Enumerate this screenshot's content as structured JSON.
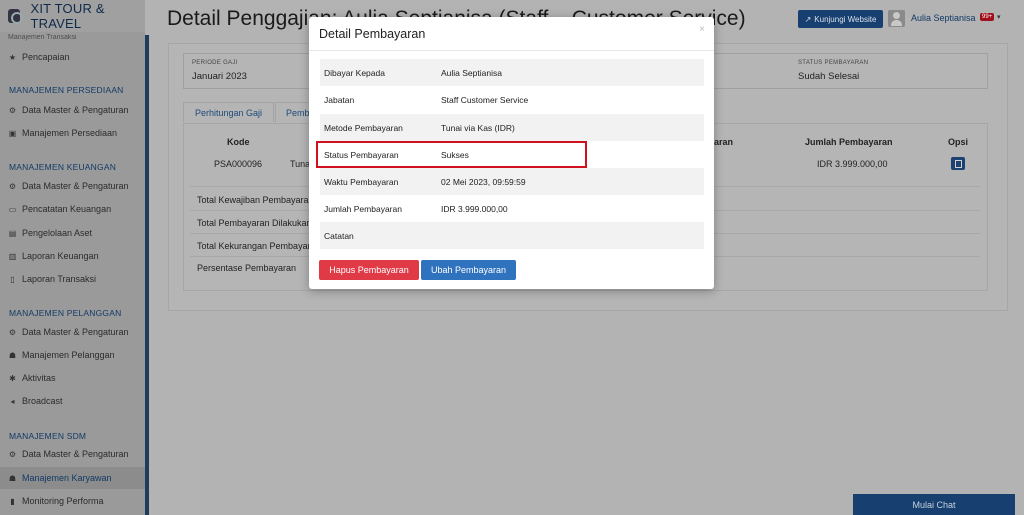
{
  "brand": {
    "name": "XIT TOUR & TRAVEL"
  },
  "sidebar": {
    "top_cut": "Manajemen Transaksi",
    "top_items": [
      {
        "label": "Pencapaian",
        "icon": "star-icon"
      }
    ],
    "sections": [
      {
        "heading": "MANAJEMEN PERSEDIAAN",
        "items": [
          {
            "label": "Data Master & Pengaturan",
            "icon": "cogs-icon"
          },
          {
            "label": "Manajemen Persediaan",
            "icon": "cubes-icon"
          }
        ]
      },
      {
        "heading": "MANAJEMEN KEUANGAN",
        "items": [
          {
            "label": "Data Master & Pengaturan",
            "icon": "cogs-icon"
          },
          {
            "label": "Pencatatan Keuangan",
            "icon": "money-icon"
          },
          {
            "label": "Pengelolaan Aset",
            "icon": "wallet-icon"
          },
          {
            "label": "Laporan Keuangan",
            "icon": "report-icon"
          },
          {
            "label": "Laporan Transaksi",
            "icon": "file-icon"
          }
        ]
      },
      {
        "heading": "MANAJEMEN PELANGGAN",
        "items": [
          {
            "label": "Data Master & Pengaturan",
            "icon": "cogs-icon"
          },
          {
            "label": "Manajemen Pelanggan",
            "icon": "users-icon"
          },
          {
            "label": "Aktivitas",
            "icon": "activity-icon"
          },
          {
            "label": "Broadcast",
            "icon": "bullhorn-icon"
          }
        ]
      },
      {
        "heading": "MANAJEMEN SDM",
        "items": [
          {
            "label": "Data Master & Pengaturan",
            "icon": "cogs-icon"
          },
          {
            "label": "Manajemen Karyawan",
            "icon": "users-icon"
          },
          {
            "label": "Monitoring Performa",
            "icon": "chart-icon"
          }
        ]
      }
    ]
  },
  "header": {
    "title": "Detail Penggajian: Aulia Septianisa (Staff – Customer Service)",
    "visit_button": "Kunjungi Website",
    "username": "Aulia Septianisa",
    "badge": "99+"
  },
  "info": {
    "period_label": "PERIODE GAJI",
    "period_value": "Januari 2023",
    "status_label": "STATUS PEMBAYARAN",
    "status_value": "Sudah Selesai"
  },
  "tabs": {
    "tab1": "Perhitungan Gaji",
    "tab2": "Pembayaran"
  },
  "table": {
    "headers": {
      "kode": "Kode",
      "metode_partial": "aran",
      "jumlah": "Jumlah Pembayaran",
      "opsi": "Opsi"
    },
    "row": {
      "kode": "PSA000096",
      "metode_partial": "Tuna",
      "jumlah": "IDR 3.999.000,00"
    }
  },
  "summary": [
    "Total Kewajiban Pembayaran",
    "Total Pembayaran Dilakukan",
    "Total Kekurangan Pembayaran",
    "Persentase Pembayaran"
  ],
  "chat": {
    "label": "Mulai Chat"
  },
  "modal": {
    "title": "Detail Pembayaran",
    "close": "×",
    "rows": [
      {
        "key": "Dibayar Kepada",
        "value": "Aulia Septianisa"
      },
      {
        "key": "Jabatan",
        "value": "Staff Customer Service"
      },
      {
        "key": "Metode Pembayaran",
        "value": "Tunai via Kas (IDR)"
      },
      {
        "key": "Status Pembayaran",
        "value": "Sukses"
      },
      {
        "key": "Waktu Pembayaran",
        "value": "02 Mei 2023, 09:59:59"
      },
      {
        "key": "Jumlah Pembayaran",
        "value": "IDR 3.999.000,00"
      },
      {
        "key": "Catatan",
        "value": ""
      }
    ],
    "delete_button": "Hapus Pembayaran",
    "edit_button": "Ubah Pembayaran"
  }
}
